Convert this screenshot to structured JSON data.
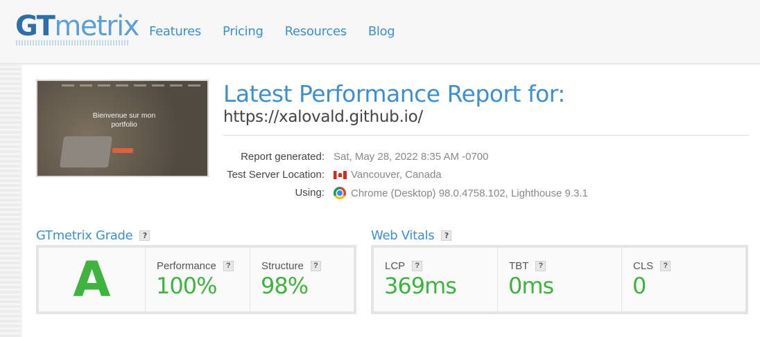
{
  "header": {
    "logo_gt": "GT",
    "logo_metrix": "metrix",
    "nav": [
      "Features",
      "Pricing",
      "Resources",
      "Blog"
    ]
  },
  "report": {
    "title": "Latest Performance Report for:",
    "url": "https://xalovald.github.io/",
    "thumbnail_heading": "Bienvenue sur mon portfolio",
    "meta": [
      {
        "label": "Report generated:",
        "value": "Sat, May 28, 2022 8:35 AM -0700"
      },
      {
        "label": "Test Server Location:",
        "value": "Vancouver, Canada",
        "icon": "canada-flag-icon"
      },
      {
        "label": "Using:",
        "value": "Chrome (Desktop) 98.0.4758.102, Lighthouse 9.3.1",
        "icon": "chrome-icon"
      }
    ]
  },
  "grade": {
    "heading": "GTmetrix Grade",
    "letter": "A",
    "performance_label": "Performance",
    "performance_value": "100%",
    "structure_label": "Structure",
    "structure_value": "98%"
  },
  "vitals": {
    "heading": "Web Vitals",
    "items": [
      {
        "label": "LCP",
        "value": "369ms"
      },
      {
        "label": "TBT",
        "value": "0ms"
      },
      {
        "label": "CLS",
        "value": "0"
      }
    ]
  },
  "help_mark": "?",
  "colors": {
    "accent": "#3d8fd0",
    "good": "#3eb33e"
  }
}
